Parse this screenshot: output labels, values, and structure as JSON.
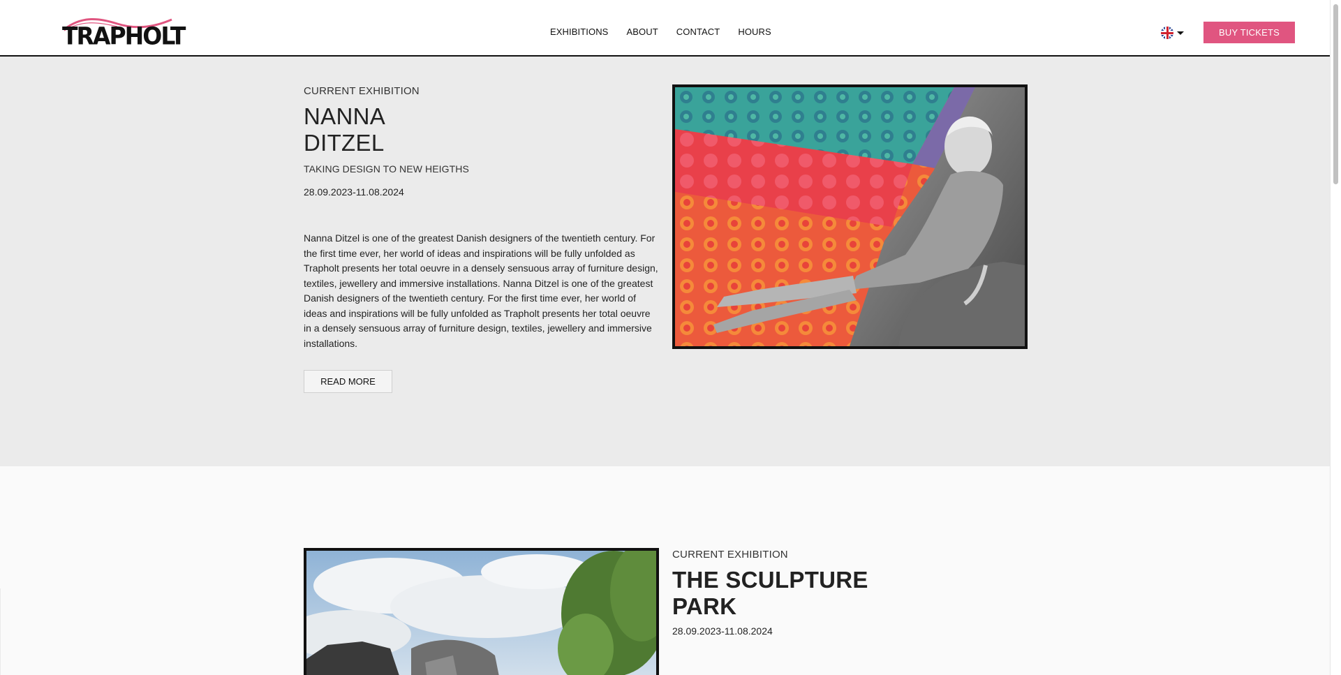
{
  "header": {
    "logo_text": "TRAPHOLT",
    "nav": [
      "EXHIBITIONS",
      "ABOUT",
      "CONTACT",
      "HOURS"
    ],
    "language_icon": "uk-flag-icon",
    "buy_tickets_label": "BUY TICKETS",
    "accent_color": "#e05580"
  },
  "exhibition1": {
    "eyebrow": "CURRENT EXHIBITION",
    "title_line1": "NANNA",
    "title_line2": "DITZEL",
    "subtitle": "TAKING DESIGN TO NEW HEIGTHS",
    "dates": "28.09.2023-11.08.2024",
    "body": "Nanna Ditzel is one of the greatest Danish designers of the twentieth century. For the first time ever, her world of ideas and inspirations will be fully unfolded as Trapholt presents her total oeuvre in a densely sensuous array of furniture design, textiles, jewellery and immersive installations. Nanna Ditzel is one of the greatest Danish designers of the twentieth century. For the first time ever, her world of ideas and inspirations will be fully unfolded as Trapholt presents her total oeuvre in a densely sensuous array of furniture design, textiles, jewellery and immersive installations.",
    "read_more_label": "READ MORE"
  },
  "exhibition2": {
    "eyebrow": "CURRENT EXHIBITION",
    "title_line1": "THE SCULPTURE",
    "title_line2": "PARK",
    "dates": "28.09.2023-11.08.2024"
  }
}
